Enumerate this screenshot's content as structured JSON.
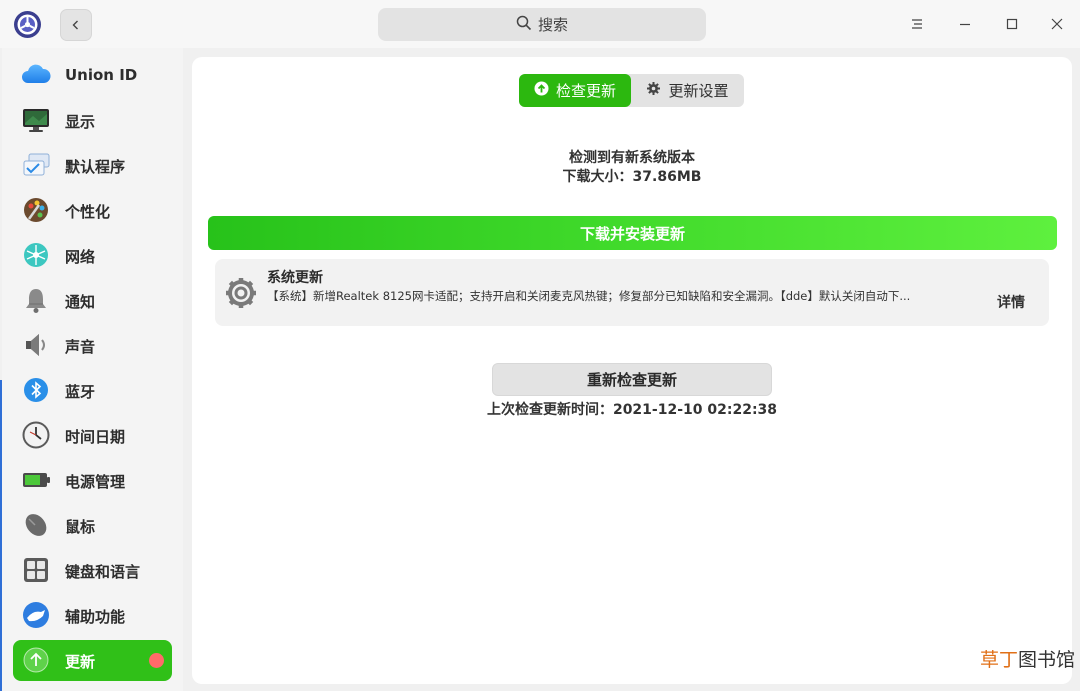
{
  "header": {
    "search_placeholder": "搜索",
    "icons": [
      "app-logo",
      "back-arrow",
      "search",
      "menu",
      "minimize",
      "maximize",
      "close"
    ]
  },
  "sidebar": {
    "items": [
      {
        "label": "Union ID",
        "icon": "cloud-icon"
      },
      {
        "label": "显示",
        "icon": "monitor-icon"
      },
      {
        "label": "默认程序",
        "icon": "default-apps-icon"
      },
      {
        "label": "个性化",
        "icon": "palette-icon"
      },
      {
        "label": "网络",
        "icon": "network-icon"
      },
      {
        "label": "通知",
        "icon": "bell-icon"
      },
      {
        "label": "声音",
        "icon": "speaker-icon"
      },
      {
        "label": "蓝牙",
        "icon": "bluetooth-icon"
      },
      {
        "label": "时间日期",
        "icon": "clock-icon"
      },
      {
        "label": "电源管理",
        "icon": "battery-icon"
      },
      {
        "label": "鼠标",
        "icon": "mouse-icon"
      },
      {
        "label": "键盘和语言",
        "icon": "keyboard-icon"
      },
      {
        "label": "辅助功能",
        "icon": "accessibility-icon"
      },
      {
        "label": "更新",
        "icon": "update-arrow-icon",
        "active": true,
        "badge": true
      }
    ]
  },
  "main": {
    "tabs": [
      {
        "label": "检查更新",
        "icon": "up-arrow-circle-icon",
        "active": true
      },
      {
        "label": "更新设置",
        "icon": "gear-icon",
        "active": false
      }
    ],
    "status_line1": "检测到有新系统版本",
    "status_line2": "下载大小：37.86MB",
    "download_button": "下载并安装更新",
    "update_item": {
      "title": "系统更新",
      "description": "【系统】新增Realtek 8125网卡适配；支持开启和关闭麦克风热键；修复部分已知缺陷和安全漏洞。【dde】默认关闭自动下...",
      "detail_link": "详情"
    },
    "recheck_button": "重新检查更新",
    "last_check": "上次检查更新时间：2021-12-10 02:22:38"
  },
  "watermark": {
    "part1": "草丁",
    "part2": "图书馆"
  },
  "colors": {
    "accent": "#2cb80f",
    "badge": "#ff6a6a",
    "download_gradient": [
      "#27c21a",
      "#5ef03e"
    ]
  }
}
